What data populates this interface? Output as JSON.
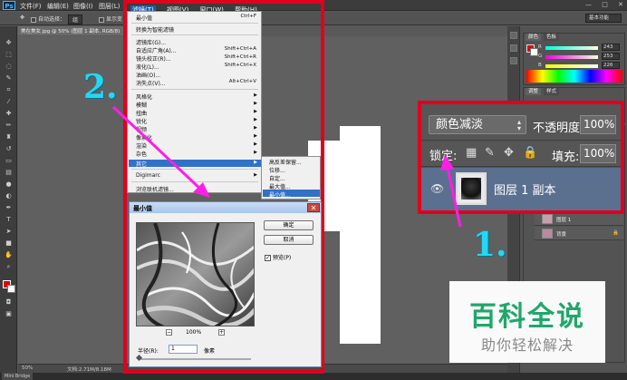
{
  "menubar": {
    "logo": "Ps",
    "items": [
      "文件(F)",
      "编辑(E)",
      "图像(I)",
      "图层(L)",
      "滤镜(T)",
      "视图(V)",
      "窗口(W)",
      "帮助(H)"
    ],
    "window_buttons": [
      "—",
      "□",
      "✕"
    ]
  },
  "options_bar": {
    "auto_select": "自动选择：",
    "auto_select_value": "组",
    "show_transform": "显示变",
    "workspace": "基本功能"
  },
  "document": {
    "tab": "美在美女.jpg @ 50% (图层 1 副本, RGB/8)"
  },
  "status_bar": {
    "zoom": "50%",
    "doc_size": "文档:2.71M/8.18M",
    "mini_bridge": "Mini Bridge"
  },
  "color_panel": {
    "tabs": [
      "颜色",
      "色板"
    ],
    "channels": [
      {
        "label": "R",
        "value": "243"
      },
      {
        "label": "G",
        "value": "253"
      },
      {
        "label": "B",
        "value": "226"
      }
    ],
    "fg_color": "#e00000",
    "bg_color": "#ffffff"
  },
  "adjust_panel": {
    "tabs": [
      "调整",
      "样式"
    ]
  },
  "layers_small": [
    {
      "name": "图层 1"
    },
    {
      "name": "背景"
    }
  ],
  "layers_zoom": {
    "blend_mode": "颜色减淡",
    "opacity_label": "不透明度:",
    "opacity_value": "100%",
    "lock_label": "锁定:",
    "fill_label": "填充:",
    "fill_value": "100%",
    "layer_name": "图层 1 副本"
  },
  "filter_menu": {
    "menu_titles": [
      "滤镜(T)",
      "视图(V)",
      "窗口(W)",
      "帮助(H)"
    ],
    "items": [
      {
        "label": "最小值",
        "shortcut": "Ctrl+F"
      },
      {
        "label": "转换为智能滤镜",
        "shortcut": ""
      },
      {
        "label": "滤镜库(G)...",
        "shortcut": ""
      },
      {
        "label": "自适应广角(A)...",
        "shortcut": "Shift+Ctrl+A"
      },
      {
        "label": "镜头校正(R)...",
        "shortcut": "Shift+Ctrl+R"
      },
      {
        "label": "液化(L)...",
        "shortcut": "Shift+Ctrl+X"
      },
      {
        "label": "油画(O)...",
        "shortcut": ""
      },
      {
        "label": "消失点(V)...",
        "shortcut": "Alt+Ctrl+V"
      },
      {
        "label": "风格化",
        "shortcut": ""
      },
      {
        "label": "模糊",
        "shortcut": ""
      },
      {
        "label": "扭曲",
        "shortcut": ""
      },
      {
        "label": "锐化",
        "shortcut": ""
      },
      {
        "label": "视频",
        "shortcut": ""
      },
      {
        "label": "像素化",
        "shortcut": ""
      },
      {
        "label": "渲染",
        "shortcut": ""
      },
      {
        "label": "杂色",
        "shortcut": ""
      },
      {
        "label": "其它",
        "shortcut": ""
      },
      {
        "label": "Digimarc",
        "shortcut": ""
      },
      {
        "label": "浏览联机滤镜...",
        "shortcut": ""
      }
    ],
    "submenu": [
      "高反差保留...",
      "位移...",
      "自定...",
      "最大值...",
      "最小值..."
    ]
  },
  "dialog": {
    "title": "最小值",
    "ok": "确定",
    "cancel": "取消",
    "preview_label": "预览(P)",
    "preview_check": "✓",
    "zoom_value": "100%",
    "zoom_out": "−",
    "zoom_in": "+",
    "radius_label": "半径(R):",
    "radius_value": "1",
    "radius_unit": "像素"
  },
  "annotations": {
    "step1": "1.",
    "step2": "2.",
    "callout_color": "#e0001e",
    "arrow_color": "#ff1ee6",
    "number_color": "#23d7f5"
  },
  "watermark": {
    "title": "百科全说",
    "subtitle": "助你轻松解决"
  }
}
